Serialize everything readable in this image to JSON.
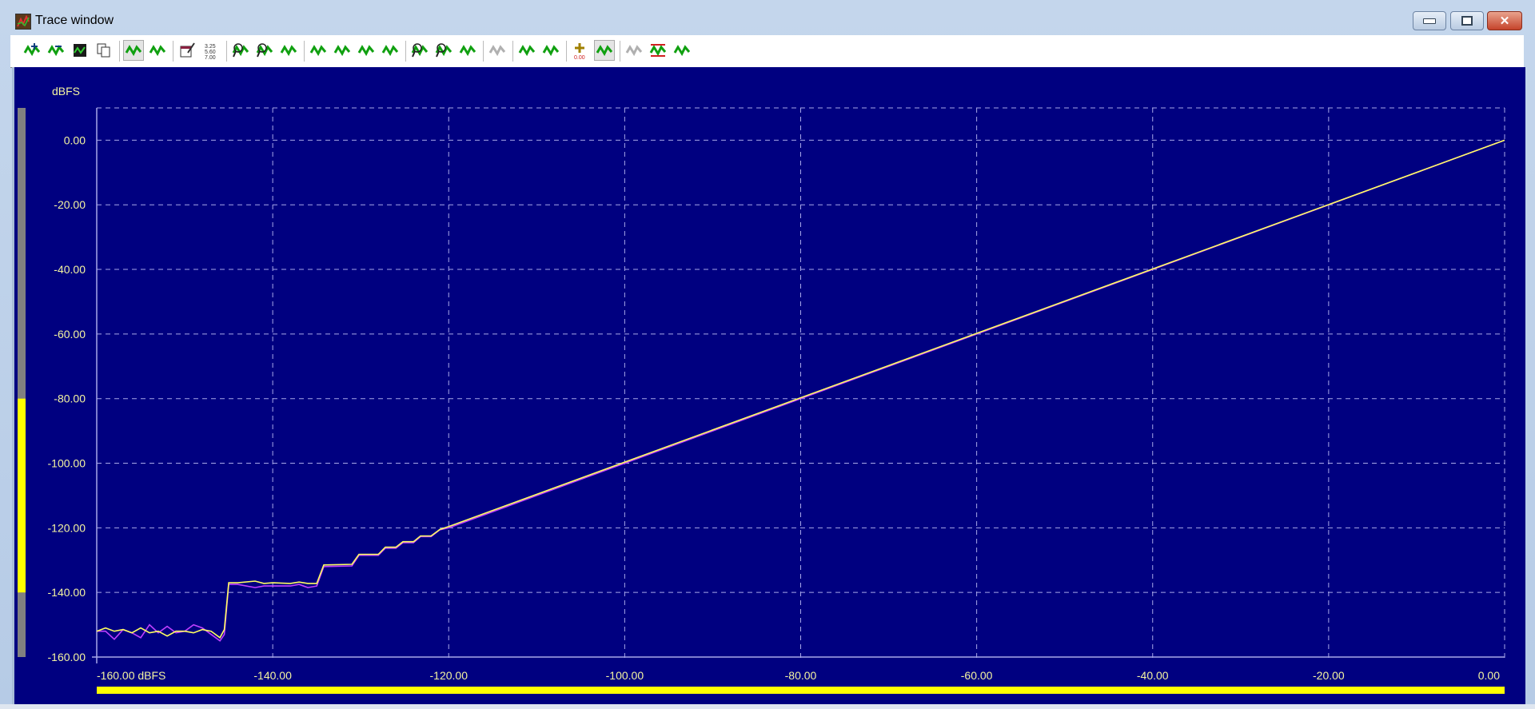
{
  "window": {
    "title": "Trace window",
    "controls": [
      "minimize",
      "maximize",
      "close"
    ]
  },
  "toolbar": {
    "buttons": [
      {
        "name": "add-trace",
        "icon": "wave-plus-icon"
      },
      {
        "name": "remove-trace",
        "icon": "wave-minus-icon"
      },
      {
        "name": "save-trace",
        "icon": "save-icon"
      },
      {
        "name": "copy",
        "icon": "copy-icon"
      },
      {
        "sep": true
      },
      {
        "name": "overlay-traces",
        "icon": "overlay-icon",
        "pressed": true
      },
      {
        "name": "trace-list",
        "icon": "list-icon"
      },
      {
        "sep": true
      },
      {
        "name": "edit-notes",
        "icon": "notes-icon"
      },
      {
        "name": "values-table",
        "icon": "values-icon",
        "text": "3.25 5.60 7.00"
      },
      {
        "sep": true
      },
      {
        "name": "zoom-in-x",
        "icon": "zoom-in-icon"
      },
      {
        "name": "zoom-out-x",
        "icon": "zoom-out-icon"
      },
      {
        "name": "autoscale",
        "icon": "autoscale-icon"
      },
      {
        "sep": true
      },
      {
        "name": "cursor-first",
        "icon": "wave-left-end-icon"
      },
      {
        "name": "cursor-prev",
        "icon": "wave-left-icon"
      },
      {
        "name": "cursor-next",
        "icon": "wave-right-icon"
      },
      {
        "name": "cursor-last",
        "icon": "wave-right-end-icon"
      },
      {
        "sep": true
      },
      {
        "name": "zoom-in-y",
        "icon": "zoom-in-bracket-icon"
      },
      {
        "name": "zoom-out-y",
        "icon": "zoom-out-bracket-icon"
      },
      {
        "name": "fit-y",
        "icon": "fit-wave-icon"
      },
      {
        "sep": true
      },
      {
        "name": "find-disabled",
        "icon": "find-icon",
        "disabled": true
      },
      {
        "sep": true
      },
      {
        "name": "peak-up",
        "icon": "peak-up-icon"
      },
      {
        "name": "peak-down",
        "icon": "peak-down-icon"
      },
      {
        "sep": true
      },
      {
        "name": "add-marker",
        "icon": "marker-plus-icon"
      },
      {
        "name": "marker-mode",
        "icon": "marker-x-icon",
        "pressed": true
      },
      {
        "sep": true
      },
      {
        "name": "undo-disabled",
        "icon": "undo-icon",
        "disabled": true
      },
      {
        "name": "limits",
        "icon": "limits-icon"
      },
      {
        "name": "axis-settings",
        "icon": "axis-arrows-icon"
      }
    ]
  },
  "chart_data": {
    "type": "line",
    "title": "",
    "ylabel": "dBFS",
    "xlabel_suffix": "dBFS",
    "xlim": [
      -160,
      0
    ],
    "ylim": [
      -160,
      10
    ],
    "grid": true,
    "x_ticks": [
      -160,
      -140,
      -120,
      -100,
      -80,
      -60,
      -40,
      -20,
      0
    ],
    "x_tick_labels": [
      "-160.00 dBFS",
      "-140.00",
      "-120.00",
      "-100.00",
      "-80.00",
      "-60.00",
      "-40.00",
      "-20.00",
      "0.00"
    ],
    "y_ticks": [
      0,
      -20,
      -40,
      -60,
      -80,
      -100,
      -120,
      -140,
      -160
    ],
    "y_tick_labels": [
      "0.00",
      "-20.00",
      "-40.00",
      "-60.00",
      "-80.00",
      "-100.00",
      "-120.00",
      "-140.00",
      "-160.00"
    ],
    "series": [
      {
        "name": "trace-magenta",
        "color": "#c040ff",
        "x": [
          -160,
          -159,
          -158,
          -157,
          -156,
          -155,
          -154,
          -153,
          -152,
          -151,
          -150,
          -149,
          -148,
          -147,
          -146,
          -145.5,
          -145,
          -144,
          -142,
          -141,
          -140,
          -138,
          -137,
          -136,
          -135,
          -134.2,
          -131,
          -130.2,
          -128,
          -127.2,
          -126,
          -125.2,
          -124,
          -123.2,
          -122,
          -121,
          -120,
          0
        ],
        "y": [
          -152,
          -152,
          -154.5,
          -151.5,
          -152.5,
          -154,
          -150,
          -152.5,
          -150.5,
          -152.5,
          -152,
          -150,
          -151,
          -153,
          -155,
          -153,
          -137.5,
          -137.5,
          -138.5,
          -138,
          -138,
          -138,
          -137.5,
          -138.5,
          -138,
          -132,
          -131.8,
          -128.5,
          -128.5,
          -126.3,
          -126.3,
          -124.6,
          -124.6,
          -122.7,
          -122.7,
          -120.6,
          -120,
          0
        ]
      },
      {
        "name": "trace-yellow",
        "color": "#ffff60",
        "x": [
          -160,
          -159,
          -158,
          -157,
          -156,
          -155,
          -154,
          -153,
          -152,
          -151,
          -150,
          -149,
          -148,
          -147,
          -146,
          -145.5,
          -145,
          -144,
          -142,
          -141,
          -140,
          -138,
          -137,
          -136,
          -135,
          -134.2,
          -131,
          -130.2,
          -128,
          -127.2,
          -126,
          -125.2,
          -124,
          -123.2,
          -122,
          -121,
          -120,
          0
        ],
        "y": [
          -152,
          -151,
          -152,
          -151.5,
          -152.5,
          -151,
          -152.5,
          -152,
          -153.5,
          -152,
          -152,
          -152.5,
          -151.5,
          -152,
          -154,
          -151.5,
          -137,
          -137,
          -136.5,
          -137.2,
          -137,
          -137.2,
          -136.8,
          -137.2,
          -137.2,
          -131.5,
          -131.3,
          -128.2,
          -128.2,
          -126,
          -126,
          -124.3,
          -124.3,
          -122.5,
          -122.5,
          -120.5,
          -119.6,
          0
        ]
      }
    ]
  },
  "sliders": {
    "vertical_range": [
      -80.0,
      -140.0
    ],
    "horizontal_range": [
      -160.0,
      0.0
    ]
  },
  "colors": {
    "plot_bg": "#000080",
    "grid": "#a8a8e8",
    "label": "#f4f4a0",
    "slider": "#ffff00"
  }
}
